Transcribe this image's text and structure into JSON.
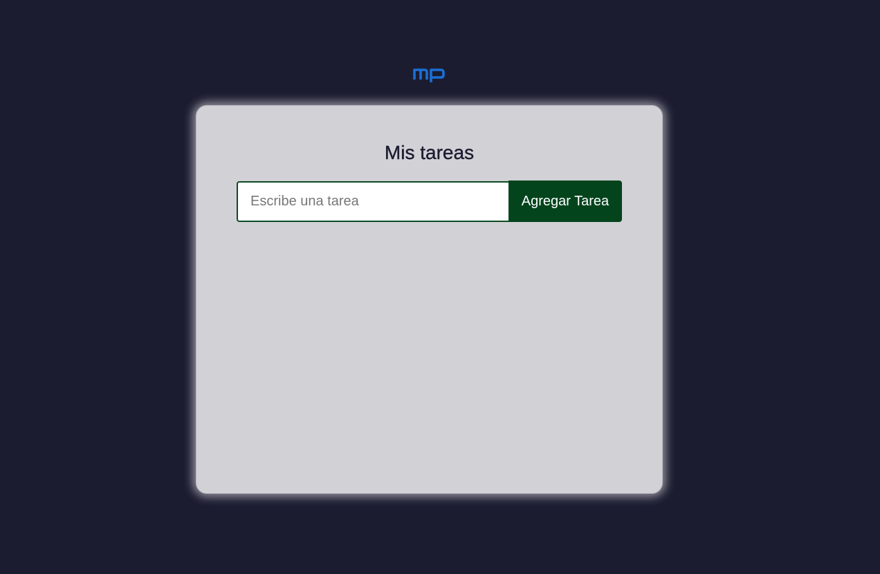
{
  "header": {
    "logo_text": "mp",
    "logo_color": "#1a6fd6"
  },
  "card": {
    "title": "Mis tareas",
    "input": {
      "value": "",
      "placeholder": "Escribe una tarea"
    },
    "add_button_label": "Agregar Tarea",
    "tasks": []
  },
  "colors": {
    "background": "#1c1c31",
    "card_background": "#d2d1d6",
    "accent_green": "#03441d",
    "title_color": "#1c1c31"
  }
}
